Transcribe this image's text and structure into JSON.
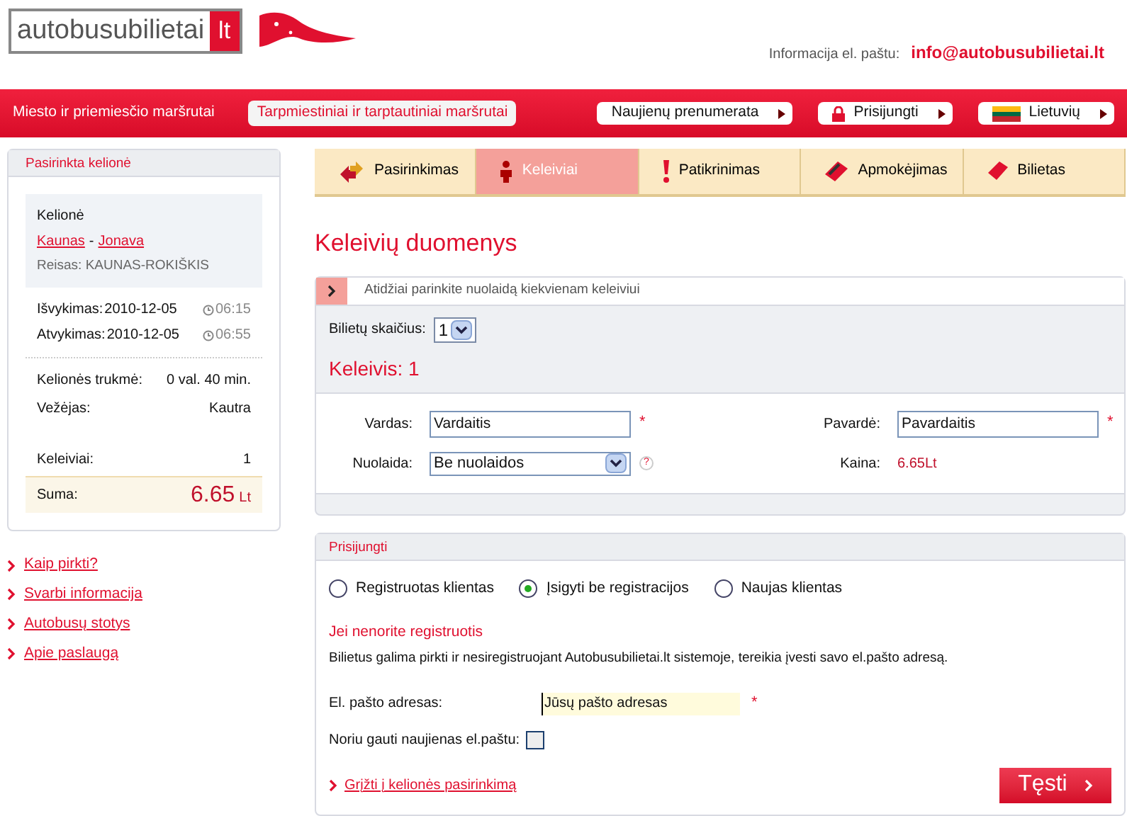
{
  "header": {
    "logo_name": "autobusubilietai",
    "logo_domain": "lt",
    "contact_label": "Informacija el. paštu:",
    "contact_email": "info@autobusubilietai.lt"
  },
  "nav": {
    "links": [
      {
        "label": "Miesto ir priemiesčio maršrutai",
        "selected": false
      },
      {
        "label": "Tarpmiestiniai ir tarptautiniai maršrutai",
        "selected": true
      }
    ],
    "buttons": [
      {
        "label": "Naujienų prenumerata",
        "kind": "plain"
      },
      {
        "label": "Prisijungti",
        "kind": "lock"
      },
      {
        "label": "Lietuvių",
        "kind": "flag"
      }
    ]
  },
  "steps": [
    {
      "label": "Pasirinkimas",
      "kind": "arrows",
      "selected": false
    },
    {
      "label": "Keleiviai",
      "kind": "person",
      "selected": true
    },
    {
      "label": "Patikrinimas",
      "kind": "exclaim",
      "selected": false
    },
    {
      "label": "Apmokėjimas",
      "kind": "card",
      "selected": false
    },
    {
      "label": "Bilietas",
      "kind": "ticket",
      "selected": false
    }
  ],
  "sidebar": {
    "title": "Pasirinkta kelionė",
    "trip_label": "Kelionė",
    "from": "Kaunas",
    "separator": "-",
    "to": "Jonava",
    "route": "Reisas: KAUNAS-ROKIŠKIS",
    "times": [
      {
        "label": "Išvykimas:",
        "date": "2010-12-05",
        "time": "06:15"
      },
      {
        "label": "Atvykimas:",
        "date": "2010-12-05",
        "time": "06:55"
      }
    ],
    "details": [
      {
        "label": "Kelionės trukmė:",
        "value": "0 val. 40 min."
      },
      {
        "label": "Vežėjas:",
        "value": "Kautra"
      }
    ],
    "passengers": {
      "label": "Keleiviai:",
      "value": "1"
    },
    "total": {
      "label": "Suma:",
      "amount": "6.65",
      "currency": "Lt"
    },
    "links": [
      "Kaip pirkti?",
      "Svarbi informacija",
      "Autobusų stotys",
      "Apie paslaugą"
    ]
  },
  "main": {
    "heading": "Keleivių duomenys",
    "passengers_panel": {
      "notice": "Atidžiai parinkite nuolaidą kiekvienam keleiviui",
      "ticket_count_label": "Bilietų skaičius:",
      "ticket_count": "1",
      "passenger_title": "Keleivis: 1",
      "first_name": {
        "label": "Vardas:",
        "value": "Vardaitis",
        "required": "*"
      },
      "last_name": {
        "label": "Pavardė:",
        "value": "Pavardaitis",
        "required": "*"
      },
      "discount": {
        "label": "Nuolaida:",
        "value": "Be nuolaidos",
        "help": "?"
      },
      "price": {
        "label": "Kaina:",
        "value": "6.65Lt"
      }
    },
    "login_panel": {
      "title": "Prisijungti",
      "options": [
        {
          "label": "Registruotas klientas",
          "selected": false
        },
        {
          "label": "Įsigyti be registracijos",
          "selected": true
        },
        {
          "label": "Naujas klientas",
          "selected": false
        }
      ],
      "subtitle": "Jei nenorite registruotis",
      "description": "Bilietus galima pirkti ir nesiregistruojant Autobusubilietai.lt sistemoje, tereikia įvesti savo el.pašto adresą.",
      "email": {
        "label": "El. pašto adresas:",
        "value": "Jūsų pašto adresas",
        "required": "*"
      },
      "newsletter": {
        "label": "Noriu gauti naujienas el.paštu:",
        "checked": false
      },
      "back_link": "Grįžti į kelionės pasirinkimą",
      "continue_button": "Tęsti"
    }
  }
}
